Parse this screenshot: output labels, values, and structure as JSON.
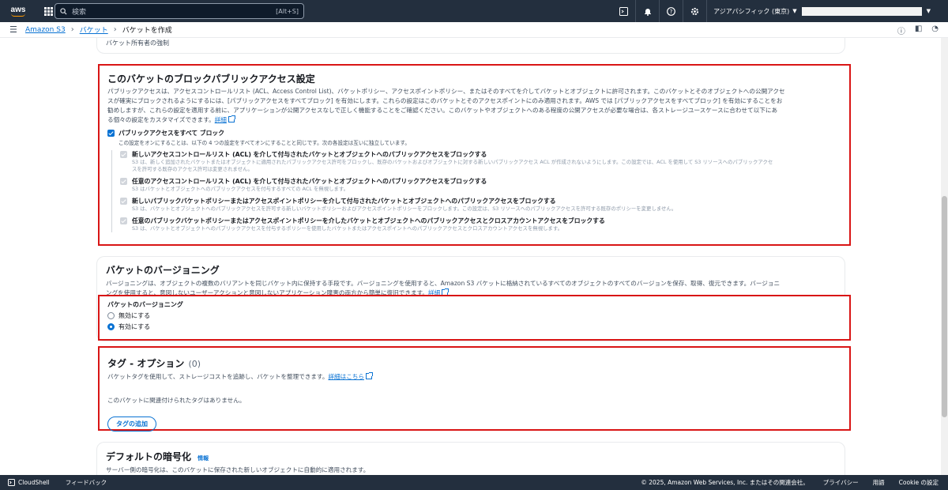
{
  "nav": {
    "logo_text": "aws",
    "search_placeholder": "検索",
    "search_shortcut": "[Alt+S]",
    "region": "アジアパシフィック (東京)"
  },
  "breadcrumb": {
    "items": [
      "Amazon S3",
      "バケット",
      "バケットを作成"
    ]
  },
  "owner_section": {
    "text": "バケット所有者の強制"
  },
  "block_public": {
    "title": "このバケットのブロックパブリックアクセス設定",
    "desc_line1": "パブリックアクセスは、アクセスコントロールリスト (ACL、Access Control List)、バケットポリシー、アクセスポイントポリシー、またはそのすべてを介してバケットとオブジェクトに許可されます。このバケットとそのオブジェクトへの公開アクセ",
    "desc_line2": "スが確実にブロックされるようにするには、[パブリックアクセスをすべてブロック] を有効にします。これらの設定はこのバケットとそのアクセスポイントにのみ適用されます。AWS では [パブリックアクセスをすべてブロック] を有効にすることをお",
    "desc_line3": "勧めしますが、これらの設定を適用する前に、アプリケーションが公開アクセスなしで正しく機能することをご確認ください。このバケットやオブジェクトへのある程度の公開アクセスが必要な場合は、各ストレージユースケースに合わせて以下にあ",
    "desc_line4": "る個々の設定をカスタマイズできます。",
    "link": "詳細",
    "block_all_label": "パブリックアクセスをすべて ブロック",
    "block_all_desc": "この設定をオンにすることは、以下の 4 つの設定をすべてオンにすることと同じです。次の各設定は互いに独立しています。",
    "options": [
      {
        "title": "新しいアクセスコントロールリスト (ACL) を介して付与されたバケットとオブジェクトへのパブリックアクセスをブロックする",
        "desc1": "S3 は、新しく追加されたバケットまたはオブジェクトに適用されたパブリックアクセス許可をブロックし、既存のバケットおよびオブジェクトに対する新しいパブリックアクセス ACL が作成されないようにします。この設定では、ACL を使用して S3 リソースへのパブリックアクセ",
        "desc2": "スを許可する既存のアクセス許可は変更されません。"
      },
      {
        "title": "任意のアクセスコントロールリスト (ACL) を介して付与されたバケットとオブジェクトへのパブリックアクセスをブロックする",
        "desc1": "S3 はバケットとオブジェクトへのパブリックアクセスを付与するすべての ACL を無視します。",
        "desc2": ""
      },
      {
        "title": "新しいパブリックバケットポリシーまたはアクセスポイントポリシーを介して付与されたバケットとオブジェクトへのパブリックアクセスをブロックする",
        "desc1": "S3 は、バケットとオブジェクトへのパブリックアクセスを許可する新しいバケットポリシーおよびアクセスポイントポリシーをブロックします。この設定は、S3 リソースへのパブリックアクセスを許可する既存のポリシーを変更しません。",
        "desc2": ""
      },
      {
        "title": "任意のパブリックバケットポリシーまたはアクセスポイントポリシーを介したバケットとオブジェクトへのパブリックアクセスとクロスアカウントアクセスをブロックする",
        "desc1": "S3 は、バケットとオブジェクトへのパブリックアクセスを付与するポリシーを使用したバケットまたはアクセスポイントへのパブリックアクセスとクロスアカウントアクセスを無視します。",
        "desc2": ""
      }
    ]
  },
  "versioning": {
    "title": "バケットのバージョニング",
    "desc_line1": "バージョニングは、オブジェクトの複数のバリアントを同じバケット内に保持する手段です。バージョニングを使用すると、Amazon S3 バケットに格納されているすべてのオブジェクトのすべてのバージョンを保存、取得、復元できます。バージョニ",
    "desc_line2": "ングを使用すると、意図しないユーザーアクションと意図しないアプリケーション障害の両方から簡単に復旧できます。",
    "link": "詳細",
    "field_label": "バケットのバージョニング",
    "options": [
      "無効にする",
      "有効にする"
    ],
    "selected": "有効にする"
  },
  "tags": {
    "title": "タグ - オプション",
    "count": "(0)",
    "desc": "バケットタグを使用して、ストレージコストを追跡し、バケットを整理できます。",
    "link": "詳細はこちら",
    "empty": "このバケットに関連付けられたタグはありません。",
    "add_button": "タグの追加"
  },
  "encryption": {
    "title": "デフォルトの暗号化",
    "info": "情報",
    "desc": "サーバー側の暗号化は、このバケットに保存された新しいオブジェクトに自動的に適用されます。"
  },
  "footer": {
    "cloudshell": "CloudShell",
    "feedback": "フィードバック",
    "copyright": "© 2025, Amazon Web Services, Inc. またはその関連会社。",
    "privacy": "プライバシー",
    "terms": "用語",
    "cookie": "Cookie の設定"
  }
}
